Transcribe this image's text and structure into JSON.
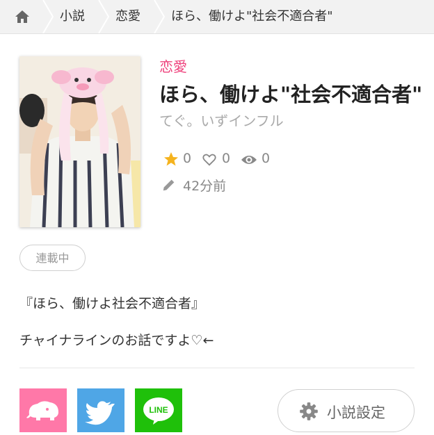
{
  "breadcrumb": {
    "items": [
      {
        "label": "小説"
      },
      {
        "label": "恋愛"
      },
      {
        "label": "ほら、働けよ\"社会不適合者\""
      }
    ]
  },
  "novel": {
    "genre": "恋愛",
    "title": "ほら、働けよ\"社会不適合者\"",
    "author": "てぐ。いずインフル",
    "stats": {
      "stars": "0",
      "likes": "0",
      "views": "0"
    },
    "updated": "42分前",
    "status": "連載中",
    "description": [
      "『ほら、働けよ社会不適合者』",
      "チャイナラインのお話ですよ♡←"
    ]
  },
  "share": {
    "line_label": "LINE"
  },
  "settings_button": {
    "label": "小説設定"
  },
  "colors": {
    "accent": "#ee3f7a",
    "star": "#f5b31e",
    "twitter": "#4fa6e6",
    "line": "#1fc00a",
    "pink": "#ff78a8"
  }
}
